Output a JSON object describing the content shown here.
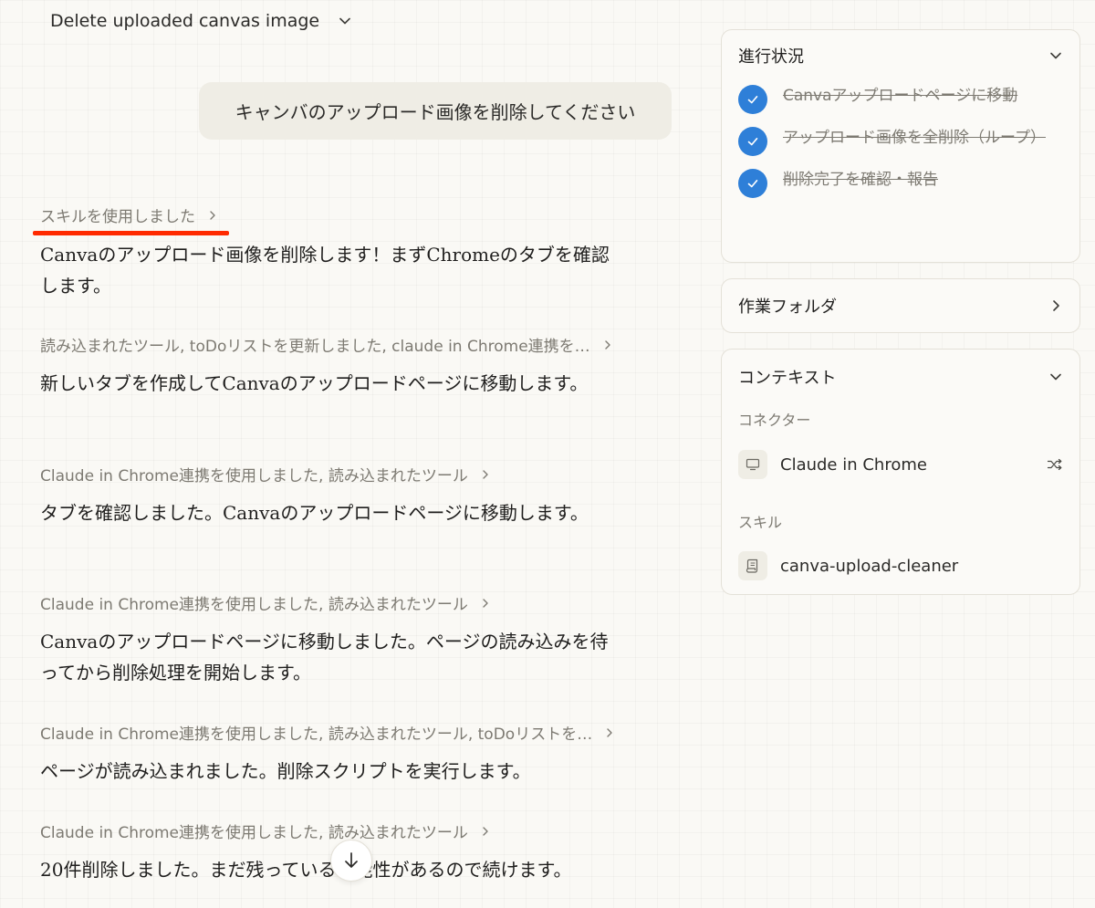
{
  "header": {
    "title": "Delete uploaded canvas image"
  },
  "user_message": "キャンバのアップロード画像を削除してください",
  "messages": [
    {
      "tool": "スキルを使用しました",
      "text": "Canvaのアップロード画像を削除します！まずChromeのタブを確認します。"
    },
    {
      "tool": "読み込まれたツール, toDoリストを更新しました, claude in Chrome連携を…",
      "text": "新しいタブを作成してCanvaのアップロードページに移動します。"
    },
    {
      "tool": "Claude in Chrome連携を使用しました, 読み込まれたツール",
      "text": "タブを確認しました。Canvaのアップロードページに移動します。"
    },
    {
      "tool": "Claude in Chrome連携を使用しました, 読み込まれたツール",
      "text": "Canvaのアップロードページに移動しました。ページの読み込みを待ってから削除処理を開始します。"
    },
    {
      "tool": "Claude in Chrome連携を使用しました, 読み込まれたツール, toDoリストを…",
      "text": "ページが読み込まれました。削除スクリプトを実行します。"
    },
    {
      "tool": "Claude in Chrome連携を使用しました, 読み込まれたツール",
      "text": "20件削除しました。まだ残っている可能性があるので続けます。"
    }
  ],
  "progress": {
    "title": "進行状況",
    "tasks": [
      {
        "label": "Canvaアップロードページに移動",
        "done": true
      },
      {
        "label": "アップロード画像を全削除（ループ）",
        "done": true
      },
      {
        "label": "削除完了を確認・報告",
        "done": true
      }
    ]
  },
  "work_folder": {
    "title": "作業フォルダ"
  },
  "context": {
    "title": "コンテキスト",
    "connectors_label": "コネクター",
    "connector_name": "Claude in Chrome",
    "skills_label": "スキル",
    "skill_name": "canva-upload-cleaner"
  },
  "colors": {
    "check": "#2e7fd8",
    "annotation": "#ff2a00",
    "background": "#faf9f5"
  }
}
